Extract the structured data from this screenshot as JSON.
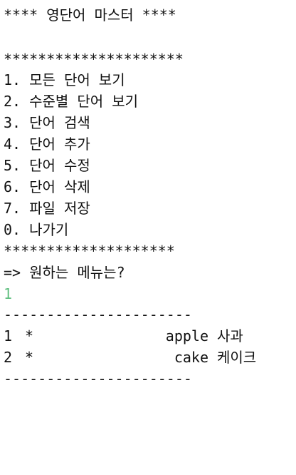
{
  "terminal": {
    "banner": "**** 영단어 마스터 ****",
    "separator_top": "*********************",
    "menu": [
      "1. 모든 단어 보기",
      "2. 수준별 단어 보기",
      "3. 단어 검색",
      "4. 단어 추가",
      "5. 단어 수정",
      "6. 단어 삭제",
      "7. 파일 저장",
      "0. 나가기"
    ],
    "separator_bottom": "********************",
    "prompt": "=> 원하는 메뉴는?",
    "input_value": "1",
    "divider": "----------------------",
    "words": [
      {
        "index": "1",
        "level": "*",
        "word": "apple",
        "meaning": "사과"
      },
      {
        "index": "2",
        "level": "*",
        "word": "cake",
        "meaning": "케이크"
      }
    ],
    "divider_bottom": "----------------------",
    "colors": {
      "background": "#ffffff",
      "text": "#111111",
      "input_echo": "#5fbf7f"
    }
  }
}
